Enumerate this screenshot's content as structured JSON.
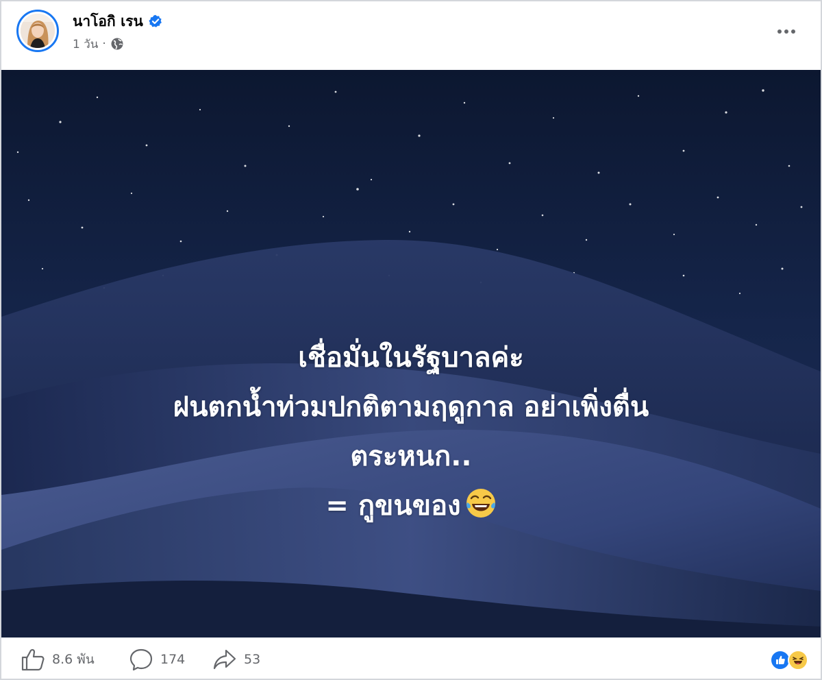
{
  "post": {
    "author": {
      "name": "นาโอกิ เรน",
      "verified": true,
      "avatar_icon": "profile-photo"
    },
    "meta": {
      "time": "1 วัน",
      "separator": "·",
      "audience_icon": "globe-icon"
    },
    "menu_icon": "more-horizontal-icon",
    "image": {
      "background": "night-sky-sand-dunes",
      "caption_lines": [
        "เชื่อมั่นในรัฐบาลค่ะ",
        "ฝนตกน้ำท่วมปกติตามฤดูกาล อย่าเพิ่งตื่น",
        "ตระหนก..",
        "= กูขนของ"
      ],
      "caption_emoji": "laughing-tears-emoji"
    },
    "stats": {
      "likes": "8.6 พัน",
      "comments": "174",
      "shares": "53"
    },
    "reactions": [
      "like-reaction-icon",
      "haha-reaction-icon"
    ]
  },
  "colors": {
    "verified_blue": "#1877f2",
    "meta_grey": "#65676b",
    "sky_top": "#0e1a33",
    "dune": "#3a4a78"
  }
}
